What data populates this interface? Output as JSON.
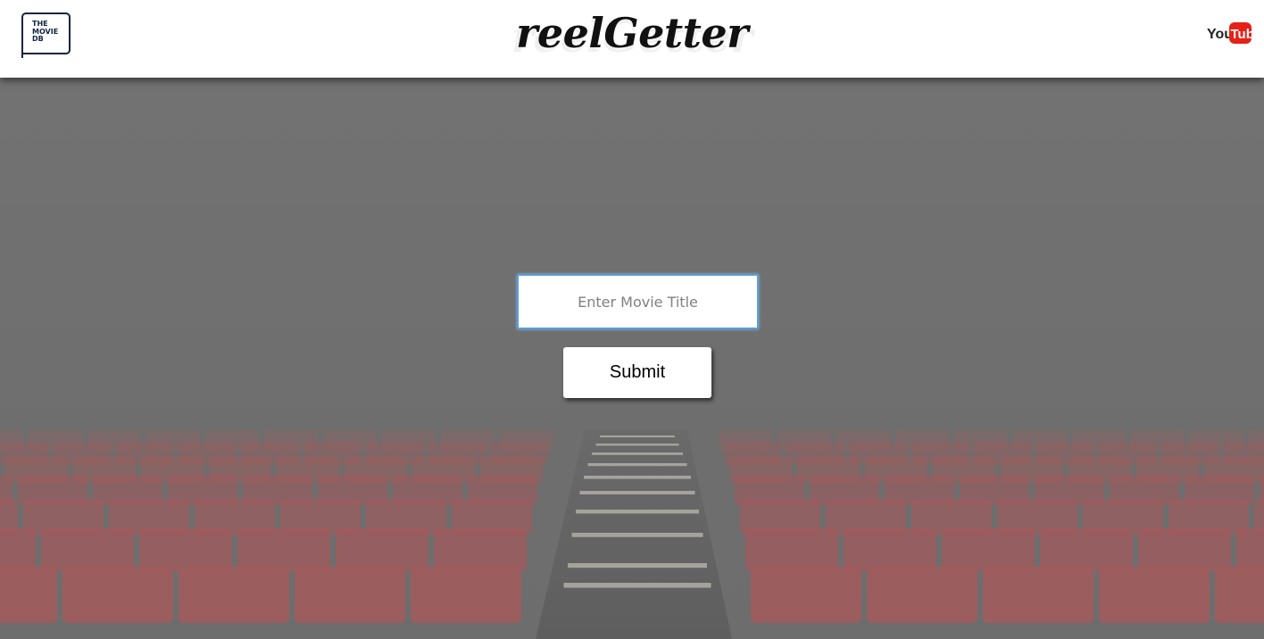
{
  "header": {
    "tmdb_logo_text": "THE\nMOVIE\nDB",
    "brand_title": "reelGetter",
    "youtube_logo": {
      "you": "You",
      "tube": "Tube",
      "color": "#e62117"
    }
  },
  "search": {
    "placeholder": "Enter Movie Title",
    "value": ""
  },
  "form": {
    "submit_label": "Submit"
  },
  "background": {
    "description_icon": "theater-seats-image",
    "seat_color": "#a35a5c",
    "overlay_color": "#707070"
  }
}
